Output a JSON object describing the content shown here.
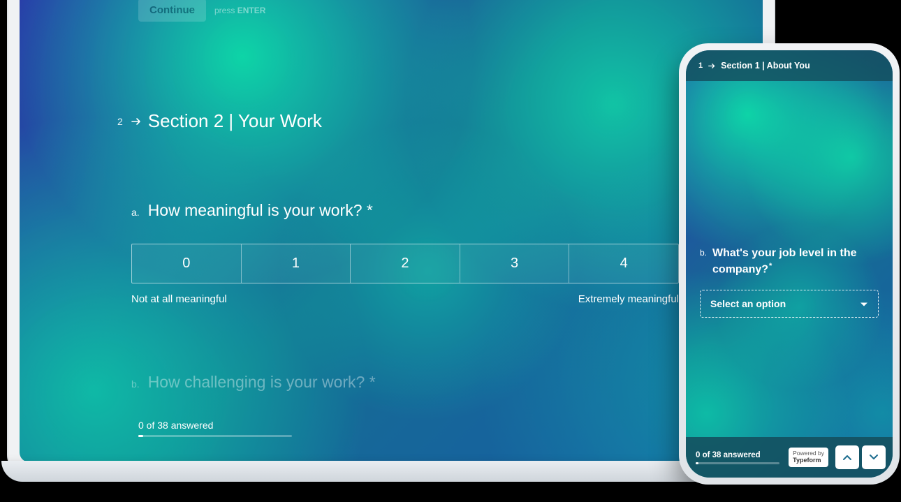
{
  "laptop": {
    "continue_label": "Continue",
    "press_prefix": "press",
    "press_key": "ENTER",
    "section_number": "2",
    "section_title": "Section 2 | Your Work",
    "question_a_letter": "a.",
    "question_a_text": "How meaningful is your work? *",
    "scale": [
      "0",
      "1",
      "2",
      "3",
      "4"
    ],
    "scale_min_label": "Not at all meaningful",
    "scale_max_label": "Extremely meaningful",
    "question_b_letter": "b.",
    "question_b_text": "How challenging is your work? *",
    "progress_text": "0 of 38 answered"
  },
  "phone": {
    "section_number": "1",
    "section_title": "Section 1 | About You",
    "question_letter": "b.",
    "question_text": "What's your job level in the company?",
    "question_required": "*",
    "select_placeholder": "Select an option",
    "progress_text": "0 of 38 answered",
    "powered_prefix": "Powered by",
    "powered_brand": "Typeform"
  }
}
